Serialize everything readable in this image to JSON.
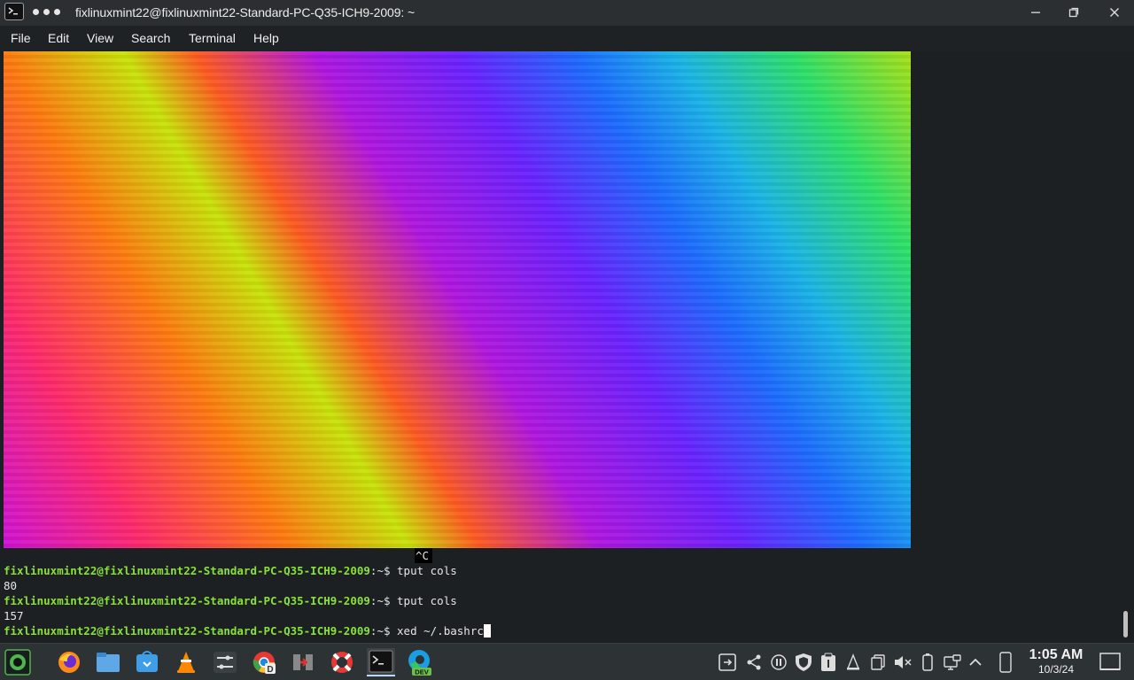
{
  "window": {
    "title": "fixlinuxmint22@fixlinuxmint22-Standard-PC-Q35-ICH9-2009: ~"
  },
  "menu": [
    "File",
    "Edit",
    "View",
    "Search",
    "Terminal",
    "Help"
  ],
  "terminal": {
    "interrupt": "^C",
    "prompt": "fixlinuxmint22@fixlinuxmint22-Standard-PC-Q35-ICH9-2009",
    "path": ":~$ ",
    "commands": [
      "tput cols",
      "tput cols",
      "xed ~/.bashrc"
    ],
    "outputs": [
      "80",
      "157"
    ]
  },
  "taskbar": {
    "apps": [
      "menu-icon",
      "firefox-icon",
      "files-icon",
      "software-manager-icon",
      "vlc-icon",
      "settings-icon",
      "chrome-dev-icon",
      "virt-manager-icon",
      "help-icon",
      "terminal-icon",
      "edge-dev-icon"
    ],
    "dev_badge": "DEV",
    "clock_time": "1:05 AM",
    "clock_date": "10/3/24"
  },
  "colors": {
    "prompt": "#8ae234",
    "terminal_bg": "#1c2023",
    "taskbar_bg": "#2d3235"
  }
}
